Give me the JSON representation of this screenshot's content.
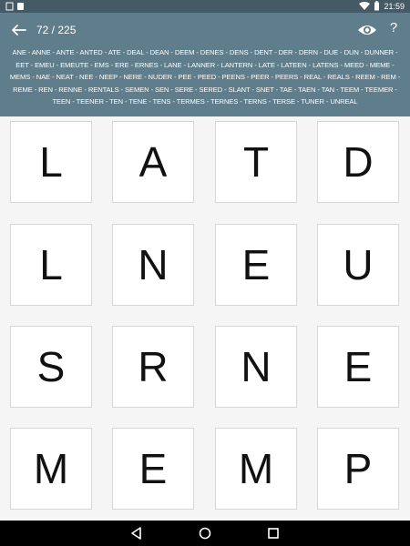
{
  "status_bar": {
    "time": "21:59"
  },
  "header": {
    "progress": "72 / 225",
    "found_words": "ANE - ANNE - ANTE - ANTED - ATE - DEAL - DEAN - DEEM - DENES - DENS - DENT - DER - DERN - DUE - DUN - DUNNER - EET - EMEU - EMEUTE - EMS - ERE - ERNES - LANE - LANNER - LANTERN - LATE - LATEEN - LATENS - MEED - MEME - MEMS - NAE - NEAT - NEE - NEEP - NERE - NUDER - PEE - PEED - PEENS - PEER - PEERS - REAL - REALS - REEM - REM - REME - REN - RENNE - RENTALS - SEMEN - SEN - SERE - SERED - SLANT - SNET - TAE - TAEN - TAN - TEEM - TEEMER - TEEN - TEENER - TEN - TENE - TENS - TERMES - TERNES - TERNS - TERSE - TUNER - UNREAL"
  },
  "board": {
    "rows": [
      [
        "L",
        "A",
        "T",
        "D"
      ],
      [
        "L",
        "N",
        "E",
        "U"
      ],
      [
        "S",
        "R",
        "N",
        "E"
      ],
      [
        "M",
        "E",
        "M",
        "P"
      ]
    ]
  },
  "icons": {
    "back": "arrow-back-icon",
    "reveal": "eye-icon",
    "help": "?",
    "nav_back": "triangle-back-icon",
    "nav_home": "circle-home-icon",
    "nav_recents": "square-recents-icon"
  }
}
